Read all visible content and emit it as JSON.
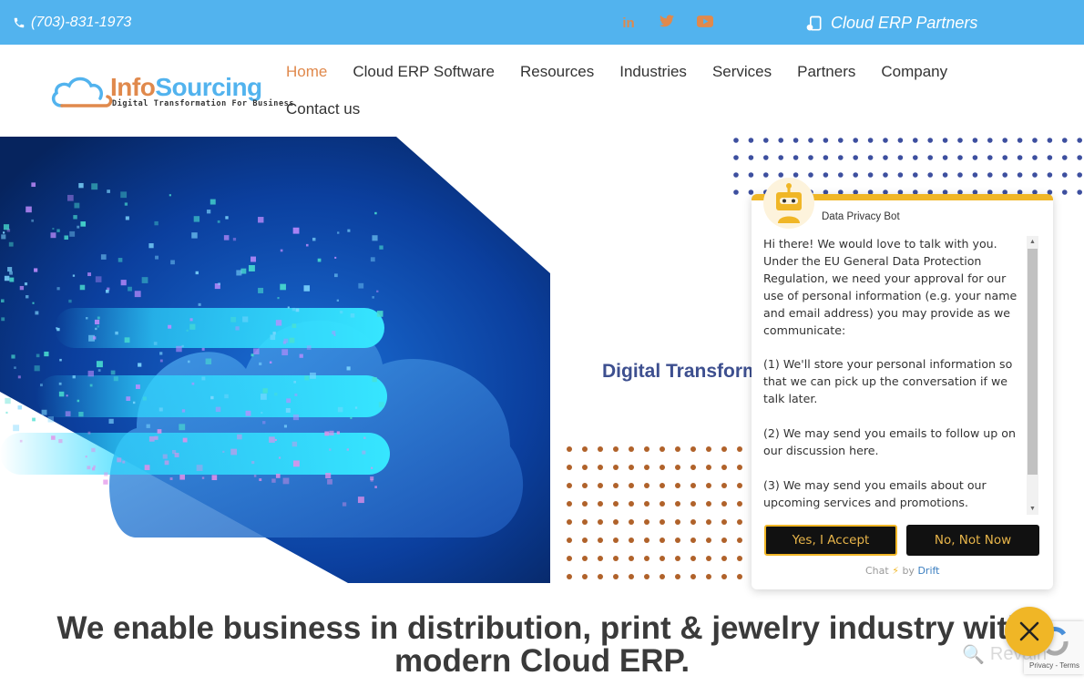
{
  "topbar": {
    "phone": "(703)-831-1973",
    "socials": [
      {
        "name": "linkedin-icon",
        "glyph": "in"
      },
      {
        "name": "twitter-icon",
        "glyph": "🐦"
      },
      {
        "name": "youtube-icon",
        "glyph": "▶"
      }
    ],
    "partners_label": "Cloud ERP Partners"
  },
  "logo": {
    "part1": "Info",
    "part2": "Sourcing",
    "tagline": "Digital Transformation For Business"
  },
  "nav": {
    "items": [
      {
        "label": "Home",
        "active": true
      },
      {
        "label": "Cloud ERP Software"
      },
      {
        "label": "Resources"
      },
      {
        "label": "Industries"
      },
      {
        "label": "Services"
      },
      {
        "label": "Partners"
      },
      {
        "label": "Company"
      },
      {
        "label": "Contact us"
      }
    ]
  },
  "hero": {
    "slide_text": "Digital Transformation"
  },
  "headline": "We enable business in distribution, print & jewelry industry with modern Cloud ERP.",
  "chat": {
    "bot_name": "Data Privacy Bot",
    "message": "Hi there! We would love to talk with you. Under the EU General Data Protection Regulation, we need your approval for our use of personal information (e.g. your name and email address) you may provide as we communicate:\n\n(1) We'll store your personal information so that we can pick up the conversation if we talk later.\n\n(2) We may send you emails to follow up on our discussion here.\n\n(3) We may send you emails about our upcoming services and promotions.",
    "accept_label": "Yes, I Accept",
    "decline_label": "No, Not Now",
    "powered_chat": "Chat",
    "powered_by": "by",
    "powered_brand": "Drift",
    "accent": "#f0b626"
  },
  "recaptcha": {
    "text": "Privacy - Terms"
  },
  "watermark": "Revain",
  "colors": {
    "topbar": "#52b3ee",
    "accent_orange": "#e0894c",
    "dot_blue": "#3d4f9f",
    "dot_orange": "#b0622a"
  }
}
